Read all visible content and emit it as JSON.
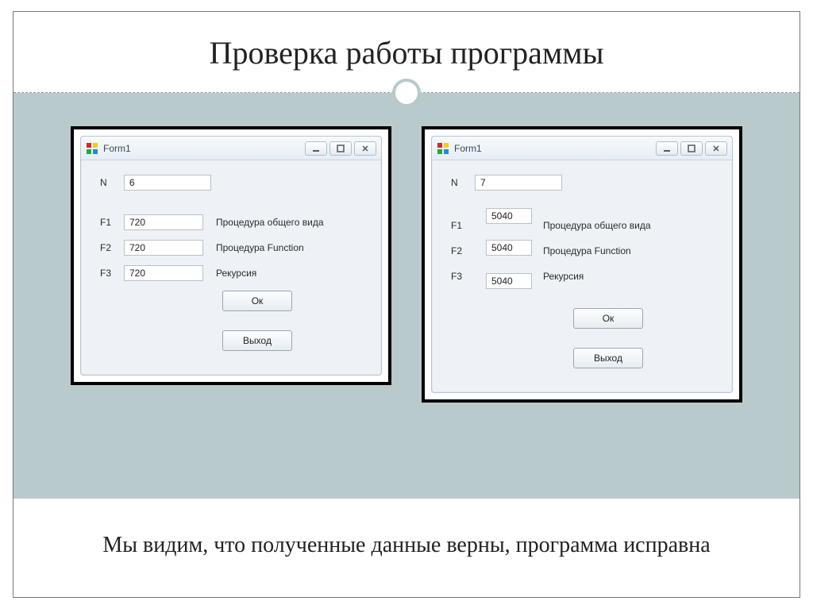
{
  "slide": {
    "title": "Проверка работы программы",
    "footer": "Мы видим, что полученные данные верны, программа исправна"
  },
  "window_common": {
    "title": "Form1",
    "buttons": {
      "ok": "Ок",
      "exit": "Выход"
    },
    "labels": {
      "n": "N",
      "f1": "F1",
      "f2": "F2",
      "f3": "F3"
    },
    "descriptions": {
      "f1": "Процедура общего вида",
      "f2": "Процедура Function",
      "f3": "Рекурсия"
    }
  },
  "left_window": {
    "n_value": "6",
    "f1_value": "720",
    "f2_value": "720",
    "f3_value": "720"
  },
  "right_window": {
    "n_value": "7",
    "f1_value": "5040",
    "f2_value": "5040",
    "f3_value": "5040"
  }
}
